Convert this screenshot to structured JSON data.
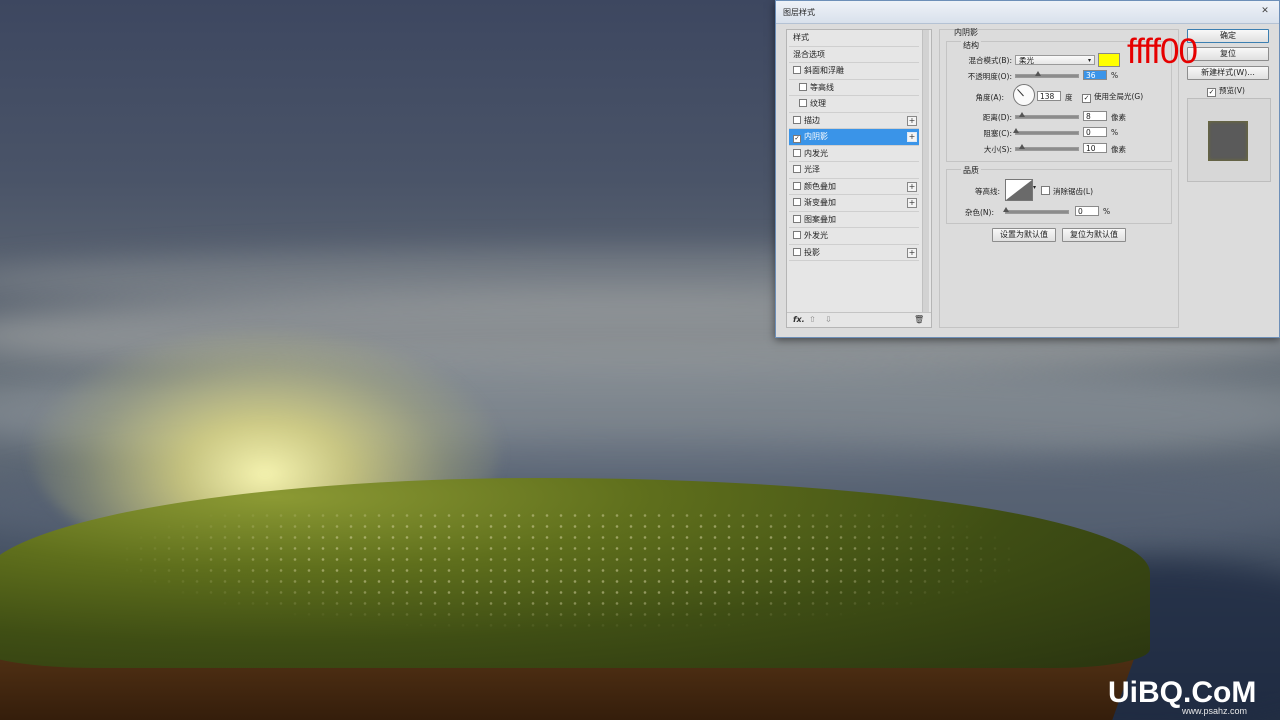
{
  "dialog": {
    "title": "图层样式",
    "close": "✕",
    "style_list": [
      {
        "label": "样式",
        "checkbox": false,
        "sub": false,
        "plus": false,
        "selected": false,
        "checked": false
      },
      {
        "label": "混合选项",
        "checkbox": false,
        "sub": false,
        "plus": false,
        "selected": false,
        "checked": false
      },
      {
        "label": "斜面和浮雕",
        "checkbox": true,
        "sub": false,
        "plus": false,
        "selected": false,
        "checked": false
      },
      {
        "label": "等高线",
        "checkbox": true,
        "sub": true,
        "plus": false,
        "selected": false,
        "checked": false
      },
      {
        "label": "纹理",
        "checkbox": true,
        "sub": true,
        "plus": false,
        "selected": false,
        "checked": false
      },
      {
        "label": "描边",
        "checkbox": true,
        "sub": false,
        "plus": true,
        "selected": false,
        "checked": false
      },
      {
        "label": "内阴影",
        "checkbox": true,
        "sub": false,
        "plus": true,
        "selected": true,
        "checked": true
      },
      {
        "label": "内发光",
        "checkbox": true,
        "sub": false,
        "plus": false,
        "selected": false,
        "checked": false
      },
      {
        "label": "光泽",
        "checkbox": true,
        "sub": false,
        "plus": false,
        "selected": false,
        "checked": false
      },
      {
        "label": "颜色叠加",
        "checkbox": true,
        "sub": false,
        "plus": true,
        "selected": false,
        "checked": false
      },
      {
        "label": "渐变叠加",
        "checkbox": true,
        "sub": false,
        "plus": true,
        "selected": false,
        "checked": false
      },
      {
        "label": "图案叠加",
        "checkbox": true,
        "sub": false,
        "plus": false,
        "selected": false,
        "checked": false
      },
      {
        "label": "外发光",
        "checkbox": true,
        "sub": false,
        "plus": false,
        "selected": false,
        "checked": false
      },
      {
        "label": "投影",
        "checkbox": true,
        "sub": false,
        "plus": true,
        "selected": false,
        "checked": false
      }
    ],
    "footer": {
      "fx": "fx.",
      "up": "⇧",
      "down": "⇩",
      "trash": "🗑"
    },
    "inner_shadow": {
      "title": "内阴影",
      "structure_title": "结构",
      "blend_mode_label": "混合模式(B):",
      "blend_mode_value": "柔光",
      "color": "#ffff00",
      "opacity_label": "不透明度(O):",
      "opacity_value": "36",
      "opacity_level": 0.36,
      "percent": "%",
      "angle_label": "角度(A):",
      "angle_value": "138",
      "angle_unit": "度",
      "global_light_label": "使用全局光(G)",
      "global_light_checked": true,
      "distance_label": "距离(D):",
      "distance_value": "8",
      "pixel_unit": "像素",
      "choke_label": "阻塞(C):",
      "choke_value": "0",
      "size_label": "大小(S):",
      "size_value": "10",
      "quality_title": "品质",
      "contour_label": "等高线:",
      "anti_alias_label": "消除锯齿(L)",
      "noise_label": "杂色(N):",
      "noise_value": "0",
      "set_default": "设置为默认值",
      "reset_default": "复位为默认值"
    },
    "buttons": {
      "ok": "确定",
      "reset": "复位",
      "new_style": "新建样式(W)...",
      "preview": "预览(V)",
      "preview_checked": true
    }
  },
  "annotation": "ffff00",
  "watermark": {
    "main": "UiBQ.CoM",
    "sub": "www.psahz.com"
  }
}
